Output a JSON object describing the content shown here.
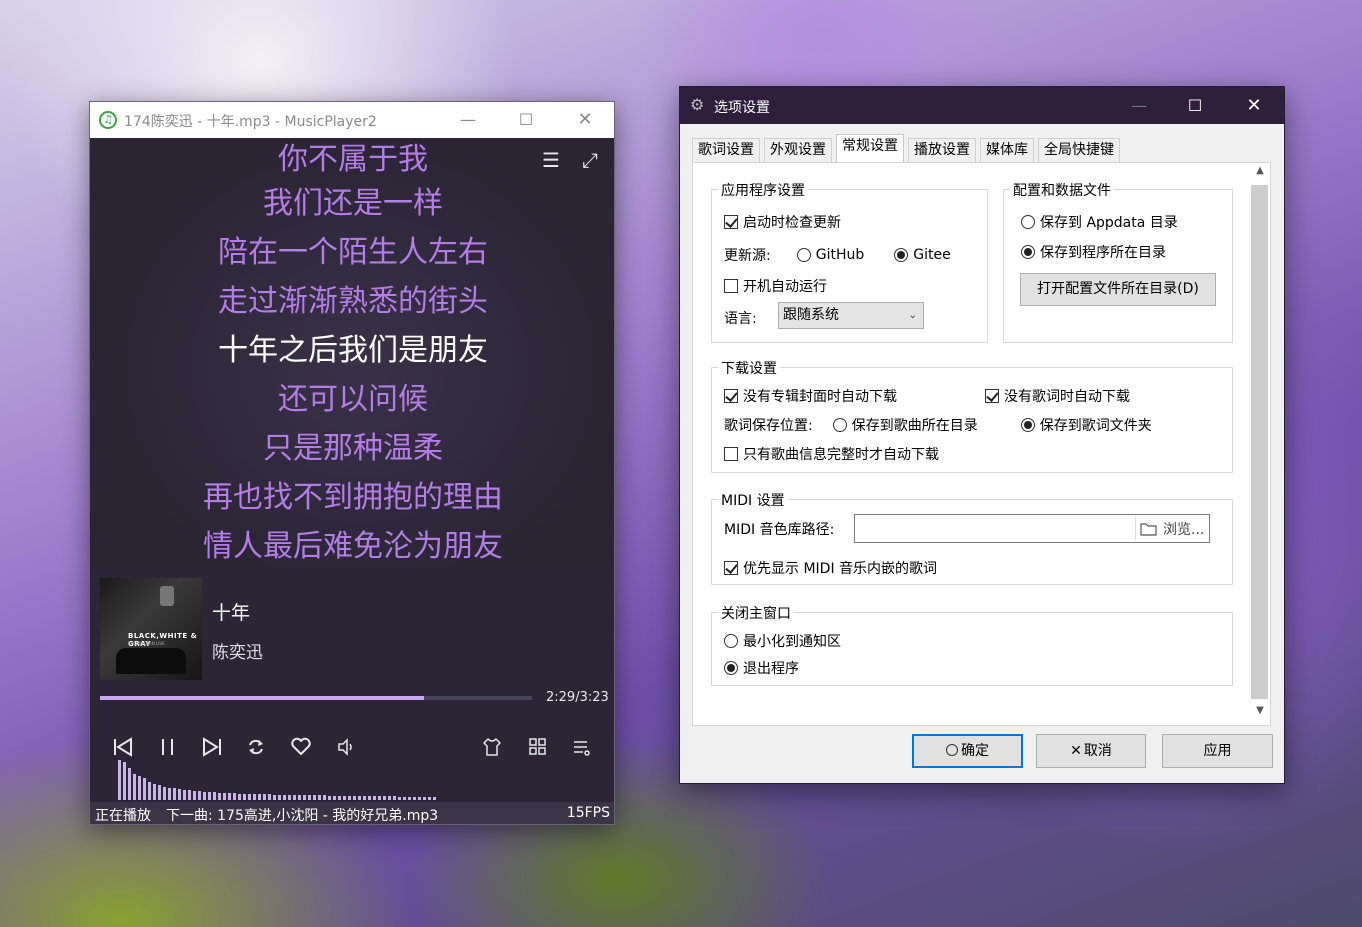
{
  "player": {
    "window_title": "174陈奕迅 - 十年.mp3 - MusicPlayer2",
    "app_icon": "♫",
    "lyrics": [
      {
        "text": "你不属于我",
        "current": false
      },
      {
        "text": "我们还是一样",
        "current": false
      },
      {
        "text": "陪在一个陌生人左右",
        "current": false
      },
      {
        "text": "走过渐渐熟悉的街头",
        "current": false
      },
      {
        "text": "十年之后我们是朋友",
        "current": true
      },
      {
        "text": "还可以问候",
        "current": false
      },
      {
        "text": "只是那种温柔",
        "current": false
      },
      {
        "text": "再也找不到拥抱的理由",
        "current": false
      },
      {
        "text": "情人最后难免沦为朋友",
        "current": false
      }
    ],
    "song_title": "十年",
    "artist": "陈奕迅",
    "cover_text": "BLACK,WHITE & GRAY",
    "cover_subtext": "EASON CHAN LIVE",
    "progress": 0.75,
    "time": "2:29/3:23",
    "status_playing": "正在播放",
    "status_next": "下一曲: 175高进,小沈阳 - 我的好兄弟.mp3",
    "fps": "15FPS",
    "accent_color": "#b47ce6",
    "spectrum": [
      40,
      38,
      32,
      26,
      24,
      22,
      18,
      16,
      15,
      13,
      12,
      12,
      11,
      10,
      10,
      9,
      9,
      8,
      8,
      8,
      7,
      7,
      7,
      7,
      6,
      6,
      6,
      6,
      6,
      6,
      6,
      5,
      5,
      5,
      5,
      5,
      5,
      5,
      5,
      5,
      5,
      5,
      4,
      4,
      4,
      4,
      4,
      4,
      4,
      4,
      4,
      4,
      4,
      4,
      4,
      4,
      3,
      3,
      3,
      3,
      3,
      3,
      3,
      3
    ]
  },
  "dialog": {
    "window_title": "选项设置",
    "tabs": [
      "歌词设置",
      "外观设置",
      "常规设置",
      "播放设置",
      "媒体库",
      "全局快捷键"
    ],
    "active_tab": 2,
    "app_settings": {
      "label": "应用程序设置",
      "check_update": "启动时检查更新",
      "update_source_label": "更新源:",
      "source_github": "GitHub",
      "source_gitee": "Gitee",
      "autostart": "开机自动运行",
      "language_label": "语言:",
      "language_value": "跟随系统"
    },
    "config_files": {
      "label": "配置和数据文件",
      "save_appdata": "保存到 Appdata 目录",
      "save_program_dir": "保存到程序所在目录",
      "open_dir_button": "打开配置文件所在目录(D)"
    },
    "download": {
      "label": "下载设置",
      "auto_cover": "没有专辑封面时自动下载",
      "auto_lyric": "没有歌词时自动下载",
      "lyric_save_label": "歌词保存位置:",
      "save_to_song_dir": "保存到歌曲所在目录",
      "save_to_lyric_dir": "保存到歌词文件夹",
      "only_complete": "只有歌曲信息完整时才自动下载"
    },
    "midi": {
      "label": "MIDI 设置",
      "soundfont_label": "MIDI 音色库路径:",
      "soundfont_value": "",
      "browse": "浏览...",
      "prefer_embedded": "优先显示 MIDI 音乐内嵌的歌词"
    },
    "close_main": {
      "label": "关闭主窗口",
      "minimize": "最小化到通知区",
      "exit": "退出程序"
    },
    "ok": "确定",
    "cancel": "取消",
    "apply": "应用"
  }
}
